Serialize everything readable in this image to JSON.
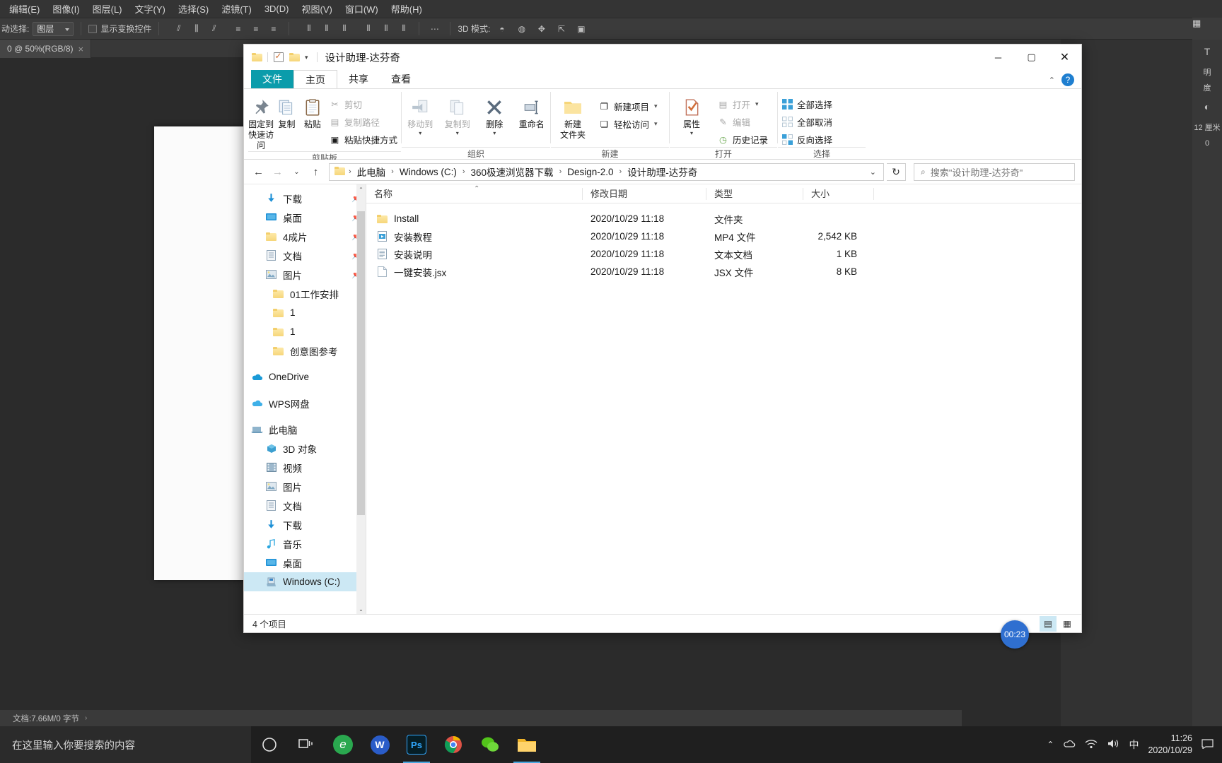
{
  "photoshop": {
    "menus": [
      "编辑(E)",
      "图像(I)",
      "图层(L)",
      "文字(Y)",
      "选择(S)",
      "滤镜(T)",
      "3D(D)",
      "视图(V)",
      "窗口(W)",
      "帮助(H)"
    ],
    "options": {
      "auto_select_label": "动选择:",
      "layer_select_value": "图层",
      "show_transform_label": "显示变换控件",
      "mode3d_label": "3D 模式:"
    },
    "document_tab": {
      "title": "0 @ 50%(RGB/8)",
      "close": "×"
    },
    "statusbar": {
      "text": "文档:7.66M/0 字节",
      "arrow": "›"
    },
    "right_dock": {
      "labels": [
        "明",
        "度",
        "0"
      ],
      "unit": "12 厘米"
    }
  },
  "explorer": {
    "title": "设计助理-达芬奇",
    "quick_access": {
      "folder_icon": "folder-icon",
      "check_icon": "properties-check-icon",
      "folder2_icon": "new-folder-icon",
      "caret": "▾"
    },
    "window_buttons": {
      "minimize": "─",
      "maximize": "▢",
      "close": "✕"
    },
    "tabs": [
      {
        "label": "文件",
        "kind": "file"
      },
      {
        "label": "主页",
        "kind": "active"
      },
      {
        "label": "共享",
        "kind": "normal"
      },
      {
        "label": "查看",
        "kind": "normal"
      }
    ],
    "tabs_right": {
      "collapse": "⌃",
      "help": "?"
    },
    "ribbon": {
      "groups": [
        {
          "name": "剪贴板",
          "big": [
            {
              "label1": "固定到",
              "label2": "快速访问",
              "icon": "pin-icon",
              "dim": false
            },
            {
              "label1": "复制",
              "label2": "",
              "icon": "copy-icon",
              "dim": false
            },
            {
              "label1": "粘贴",
              "label2": "",
              "icon": "paste-icon",
              "dim": false
            }
          ],
          "small": [
            {
              "label": "剪切",
              "icon": "scissors-icon",
              "dim": true
            },
            {
              "label": "复制路径",
              "icon": "copy-path-icon",
              "dim": true
            },
            {
              "label": "粘贴快捷方式",
              "icon": "paste-shortcut-icon",
              "dim": false
            }
          ]
        },
        {
          "name": "组织",
          "big": [
            {
              "label1": "移动到",
              "label2": "",
              "icon": "move-to-icon",
              "dim": true,
              "caret": "▾"
            },
            {
              "label1": "复制到",
              "label2": "",
              "icon": "copy-to-icon",
              "dim": true,
              "caret": "▾"
            },
            {
              "label1": "删除",
              "label2": "",
              "icon": "delete-x-icon",
              "dim": false,
              "caret": "▾"
            },
            {
              "label1": "重命名",
              "label2": "",
              "icon": "rename-icon",
              "dim": false
            }
          ],
          "small": []
        },
        {
          "name": "新建",
          "big": [
            {
              "label1": "新建",
              "label2": "文件夹",
              "icon": "new-folder-icon",
              "dim": false
            }
          ],
          "small": [
            {
              "label": "新建项目",
              "icon": "new-item-icon",
              "dim": false,
              "caret": "▾"
            },
            {
              "label": "轻松访问",
              "icon": "easy-access-icon",
              "dim": false,
              "caret": "▾"
            }
          ]
        },
        {
          "name": "打开",
          "big": [
            {
              "label1": "属性",
              "label2": "",
              "icon": "properties-check-icon",
              "dim": false,
              "caret": "▾"
            }
          ],
          "small": [
            {
              "label": "打开",
              "icon": "open-icon",
              "dim": true,
              "caret": "▾"
            },
            {
              "label": "编辑",
              "icon": "edit-icon",
              "dim": true
            },
            {
              "label": "历史记录",
              "icon": "history-icon",
              "dim": false
            }
          ]
        },
        {
          "name": "选择",
          "big": [],
          "small": [
            {
              "label": "全部选择",
              "icon": "select-all-icon",
              "dim": false
            },
            {
              "label": "全部取消",
              "icon": "select-none-icon",
              "dim": false
            },
            {
              "label": "反向选择",
              "icon": "invert-selection-icon",
              "dim": false
            }
          ]
        }
      ]
    },
    "addressbar": {
      "back": "←",
      "forward": "→",
      "recent": "⌄",
      "up": "↑",
      "crumbs": [
        "此电脑",
        "Windows (C:)",
        "360极速浏览器下载",
        "Design-2.0",
        "设计助理-达芬奇"
      ],
      "separator": "›",
      "dropdown_caret": "⌄",
      "refresh": "↻"
    },
    "search": {
      "placeholder": "搜索\"设计助理-达芬奇\"",
      "icon": "search-icon"
    },
    "nav_items": [
      {
        "label": "下载",
        "icon": "download-icon",
        "indent": 1,
        "pinned": true
      },
      {
        "label": "桌面",
        "icon": "desktop-icon",
        "indent": 1,
        "pinned": true
      },
      {
        "label": "4成片",
        "icon": "folder-icon",
        "indent": 1,
        "pinned": true
      },
      {
        "label": "文档",
        "icon": "documents-icon",
        "indent": 1,
        "pinned": true
      },
      {
        "label": "图片",
        "icon": "pictures-icon",
        "indent": 1,
        "pinned": true
      },
      {
        "label": "01工作安排",
        "icon": "folder-icon",
        "indent": 1,
        "pinned": false
      },
      {
        "label": "1",
        "icon": "folder-icon",
        "indent": 1,
        "pinned": false
      },
      {
        "label": "1",
        "icon": "folder-icon",
        "indent": 1,
        "pinned": false
      },
      {
        "label": "创意图参考",
        "icon": "folder-icon",
        "indent": 1,
        "pinned": false
      },
      {
        "label": "OneDrive",
        "icon": "onedrive-cloud-icon",
        "indent": 0,
        "pinned": false,
        "gap_before": true
      },
      {
        "label": "WPS网盘",
        "icon": "wps-cloud-icon",
        "indent": 0,
        "pinned": false,
        "gap_before": true
      },
      {
        "label": "此电脑",
        "icon": "this-pc-icon",
        "indent": 0,
        "pinned": false,
        "gap_before": true
      },
      {
        "label": "3D 对象",
        "icon": "3d-objects-icon",
        "indent": 1,
        "pinned": false
      },
      {
        "label": "视频",
        "icon": "videos-icon",
        "indent": 1,
        "pinned": false
      },
      {
        "label": "图片",
        "icon": "pictures-icon",
        "indent": 1,
        "pinned": false
      },
      {
        "label": "文档",
        "icon": "documents-icon",
        "indent": 1,
        "pinned": false
      },
      {
        "label": "下载",
        "icon": "download-icon",
        "indent": 1,
        "pinned": false
      },
      {
        "label": "音乐",
        "icon": "music-note-icon",
        "indent": 1,
        "pinned": false
      },
      {
        "label": "桌面",
        "icon": "desktop-icon",
        "indent": 1,
        "pinned": false
      },
      {
        "label": "Windows (C:)",
        "icon": "drive-icon",
        "indent": 1,
        "pinned": false,
        "selected": true
      }
    ],
    "columns": [
      {
        "label": "名称",
        "key": "name"
      },
      {
        "label": "修改日期",
        "key": "date"
      },
      {
        "label": "类型",
        "key": "type"
      },
      {
        "label": "大小",
        "key": "size"
      }
    ],
    "sort_marker": "⌃",
    "files": [
      {
        "name": "Install",
        "date": "2020/10/29 11:18",
        "type": "文件夹",
        "size": "",
        "icon": "folder-icon"
      },
      {
        "name": "安装教程",
        "date": "2020/10/29 11:18",
        "type": "MP4 文件",
        "size": "2,542 KB",
        "icon": "video-file-icon"
      },
      {
        "name": "安装说明",
        "date": "2020/10/29 11:18",
        "type": "文本文档",
        "size": "1 KB",
        "icon": "text-file-icon"
      },
      {
        "name": "一键安装.jsx",
        "date": "2020/10/29 11:18",
        "type": "JSX 文件",
        "size": "8 KB",
        "icon": "generic-file-icon"
      }
    ],
    "status": {
      "count_text": "4 个项目"
    },
    "view_buttons": [
      {
        "name": "details-view",
        "glyph": "▤",
        "active": true
      },
      {
        "name": "large-icons-view",
        "glyph": "▦",
        "active": false
      }
    ]
  },
  "recorder": {
    "time": "00:23"
  },
  "taskbar": {
    "search_placeholder": "在这里输入你要搜索的内容",
    "items": [
      {
        "name": "cortana-icon",
        "glyph": "◯"
      },
      {
        "name": "task-view-icon",
        "glyph": "❏"
      },
      {
        "name": "edge-icon",
        "glyph": "e",
        "color": "#2aa84f"
      },
      {
        "name": "wps-writer-icon",
        "glyph": "W",
        "color": "#2a5cc8"
      },
      {
        "name": "photoshop-icon",
        "glyph": "Ps",
        "color": "#31a8ff"
      },
      {
        "name": "chrome-icon",
        "glyph": "◉",
        "color": "#de5246"
      },
      {
        "name": "wechat-icon",
        "glyph": "◍",
        "color": "#52c41a"
      },
      {
        "name": "file-explorer-icon",
        "glyph": "▰",
        "color": "#ffc83d"
      }
    ],
    "tray": {
      "chevron": "⌃",
      "network": "◰",
      "volume": "🔊",
      "ime": "中",
      "time": "11:26",
      "date": "2020/10/29",
      "notification": "▭"
    }
  }
}
